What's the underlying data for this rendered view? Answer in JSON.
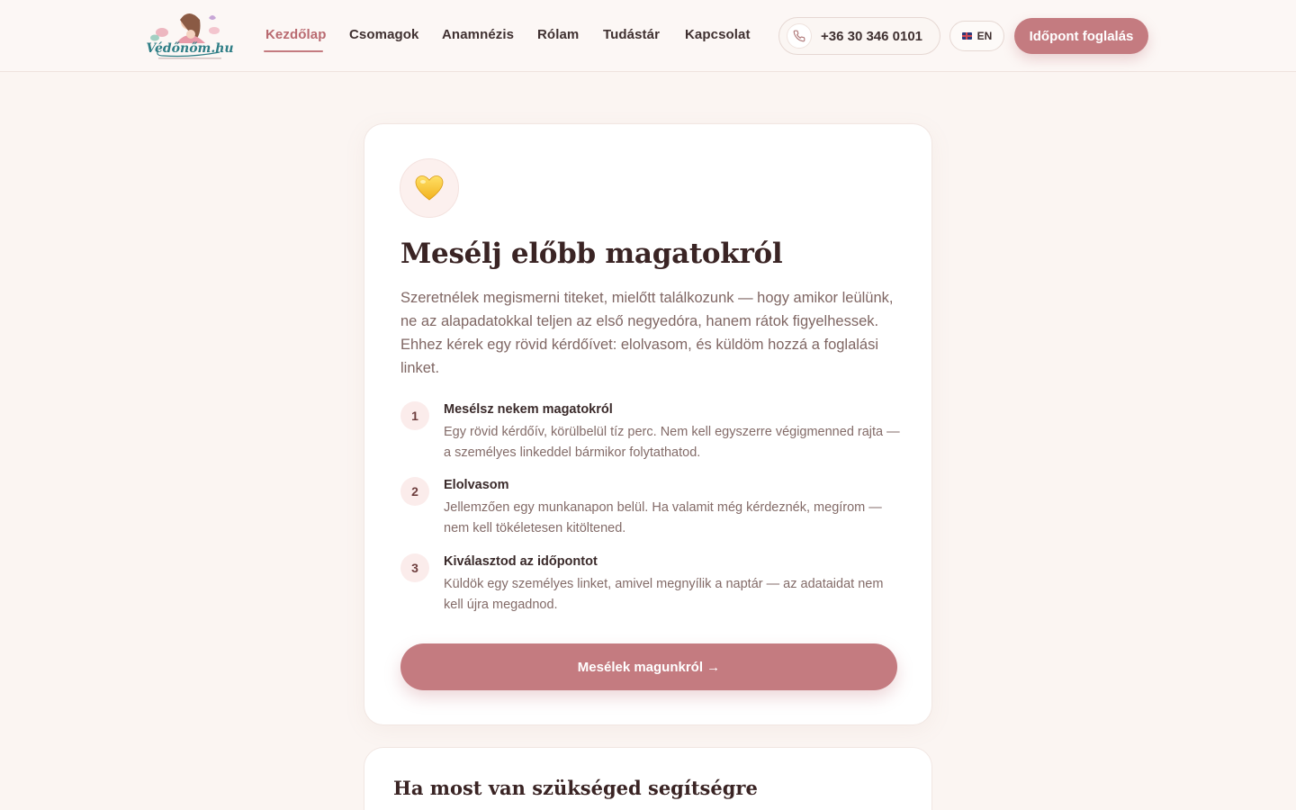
{
  "brand": {
    "logo_text": "Védőnőm.hu",
    "icon": "mother-baby-logo"
  },
  "nav": {
    "items": [
      {
        "label": "Kezdőlap",
        "active": true
      },
      {
        "label": "Csomagok",
        "active": false
      },
      {
        "label": "Anamnézis",
        "active": false
      },
      {
        "label": "Rólam",
        "active": false
      },
      {
        "label": "Tudástár",
        "active": false
      },
      {
        "label": "Kapcsolat",
        "active": false
      }
    ]
  },
  "header": {
    "phone": "+36 30 346 0101",
    "phone_icon": "phone-icon",
    "language": "EN",
    "language_icon": "uk-flag-icon",
    "book_label": "Időpont foglalás"
  },
  "intro_card": {
    "icon": "yellow-heart-icon",
    "title": "Mesélj előbb magatokról",
    "text": "Szeretnélek megismerni titeket, mielőtt találkozunk — hogy amikor leülünk, ne az alapadatokkal teljen az első negyedóra, hanem rátok figyelhessek. Ehhez kérek egy rövid kérdőívet: elolvasom, és küldöm hozzá a foglalási linket.",
    "steps": [
      {
        "number": "1",
        "title": "Mesélsz nekem magatokról",
        "desc": "Egy rövid kérdőív, körülbelül tíz perc. Nem kell egyszerre végigmenned rajta — a személyes linkeddel bármikor folytathatod."
      },
      {
        "number": "2",
        "title": "Elolvasom",
        "desc": "Jellemzően egy munkanapon belül. Ha valamit még kérdeznék, megírom — nem kell tökéletesen kitöltened."
      },
      {
        "number": "3",
        "title": "Kiválasztod az időpontot",
        "desc": "Küldök egy személyes linket, amivel megnyílik a naptár — az adataidat nem kell újra megadnod."
      }
    ],
    "cta_label": "Mesélek magunkról →"
  },
  "help_card": {
    "title": "Ha most van szükséged segítségre"
  },
  "colors": {
    "accent": "#c47b80",
    "background": "#fbf5f2",
    "card": "#ffffff",
    "heading": "#3a2424",
    "body_text": "#7f6663"
  }
}
